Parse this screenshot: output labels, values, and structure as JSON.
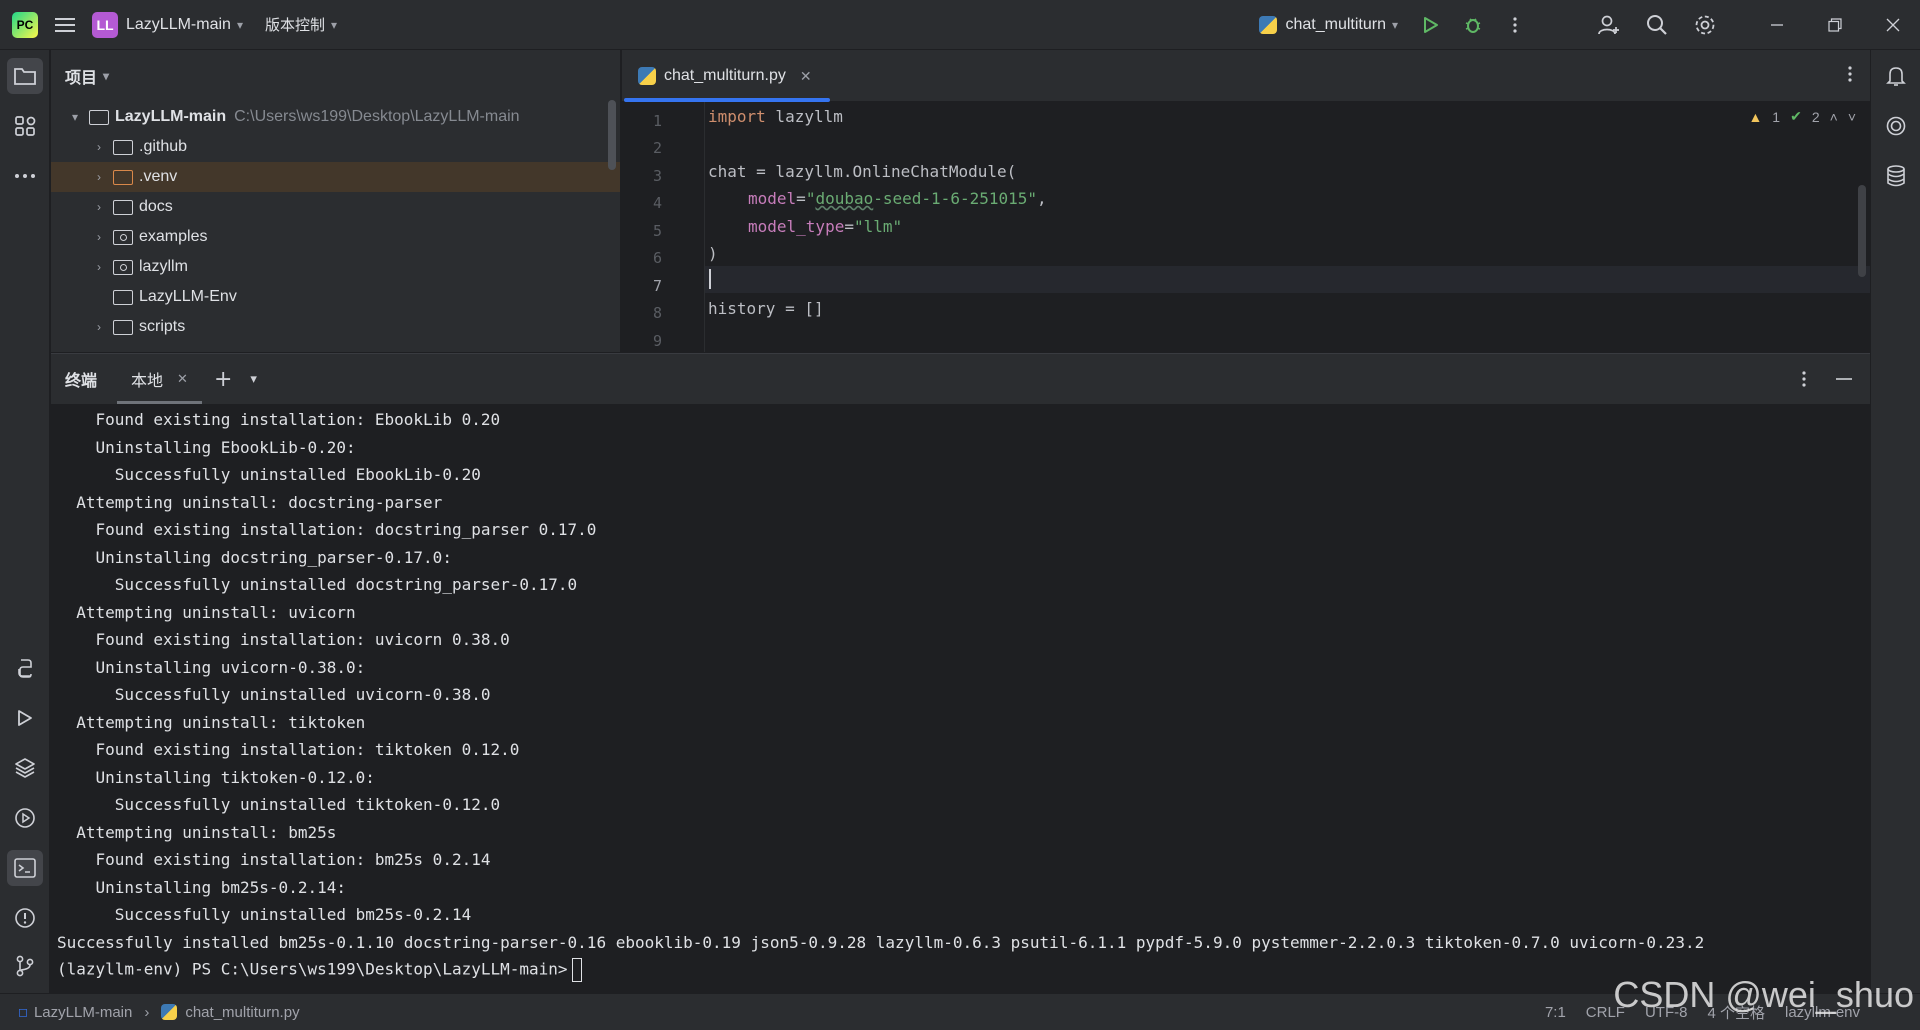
{
  "titlebar": {
    "project_badge": "LL",
    "project_name": "LazyLLM-main",
    "vcs_label": "版本控制",
    "run_config": "chat_multiturn"
  },
  "project_panel": {
    "title": "项目",
    "root": {
      "name": "LazyLLM-main",
      "path": "C:\\Users\\ws199\\Desktop\\LazyLLM-main"
    },
    "items": [
      {
        "name": ".github",
        "icon": "folder-icon"
      },
      {
        "name": ".venv",
        "icon": "folder-excluded-icon"
      },
      {
        "name": "docs",
        "icon": "folder-icon"
      },
      {
        "name": "examples",
        "icon": "package-folder-icon"
      },
      {
        "name": "lazyllm",
        "icon": "package-folder-icon"
      },
      {
        "name": "LazyLLM-Env",
        "icon": "folder-icon"
      },
      {
        "name": "scripts",
        "icon": "folder-icon"
      }
    ]
  },
  "editor": {
    "tab_name": "chat_multiturn.py",
    "inspections": {
      "warnings": "1",
      "weak_warnings": "2"
    },
    "line_numbers": [
      "1",
      "2",
      "3",
      "4",
      "5",
      "6",
      "7",
      "8",
      "9"
    ],
    "code": {
      "l1_kw": "import",
      "l1_rest": " lazyllm",
      "l3": "chat = lazyllm.OnlineChatModule(",
      "l4_param": "model",
      "l4_eq": "=",
      "l4_q1": "\"",
      "l4_wavy": "doubao",
      "l4_str": "-seed-1-6-251015\"",
      "l4_comma": ",",
      "l5_param": "model_type",
      "l5_eq": "=",
      "l5_str": "\"llm\"",
      "l6": ")",
      "l8": "history = []"
    }
  },
  "terminal": {
    "title": "终端",
    "tab_local": "本地",
    "lines": [
      "    Found existing installation: EbookLib 0.20",
      "    Uninstalling EbookLib-0.20:",
      "      Successfully uninstalled EbookLib-0.20",
      "  Attempting uninstall: docstring-parser",
      "    Found existing installation: docstring_parser 0.17.0",
      "    Uninstalling docstring_parser-0.17.0:",
      "      Successfully uninstalled docstring_parser-0.17.0",
      "  Attempting uninstall: uvicorn",
      "    Found existing installation: uvicorn 0.38.0",
      "    Uninstalling uvicorn-0.38.0:",
      "      Successfully uninstalled uvicorn-0.38.0",
      "  Attempting uninstall: tiktoken",
      "    Found existing installation: tiktoken 0.12.0",
      "    Uninstalling tiktoken-0.12.0:",
      "      Successfully uninstalled tiktoken-0.12.0",
      "  Attempting uninstall: bm25s",
      "    Found existing installation: bm25s 0.2.14",
      "    Uninstalling bm25s-0.2.14:",
      "      Successfully uninstalled bm25s-0.2.14",
      "Successfully installed bm25s-0.1.10 docstring-parser-0.16 ebooklib-0.19 json5-0.9.28 lazyllm-0.6.3 psutil-6.1.1 pypdf-5.9.0 pystemmer-2.2.0.3 tiktoken-0.7.0 uvicorn-0.23.2"
    ],
    "prompt": "(lazyllm-env) PS C:\\Users\\ws199\\Desktop\\LazyLLM-main>"
  },
  "statusbar": {
    "breadcrumb_project": "LazyLLM-main",
    "breadcrumb_file": "chat_multiturn.py",
    "position": "7:1",
    "line_sep": "CRLF",
    "encoding": "UTF-8",
    "indent": "4 个空格",
    "interpreter": "lazyllm-env"
  },
  "watermark": "CSDN @wei_shuo"
}
